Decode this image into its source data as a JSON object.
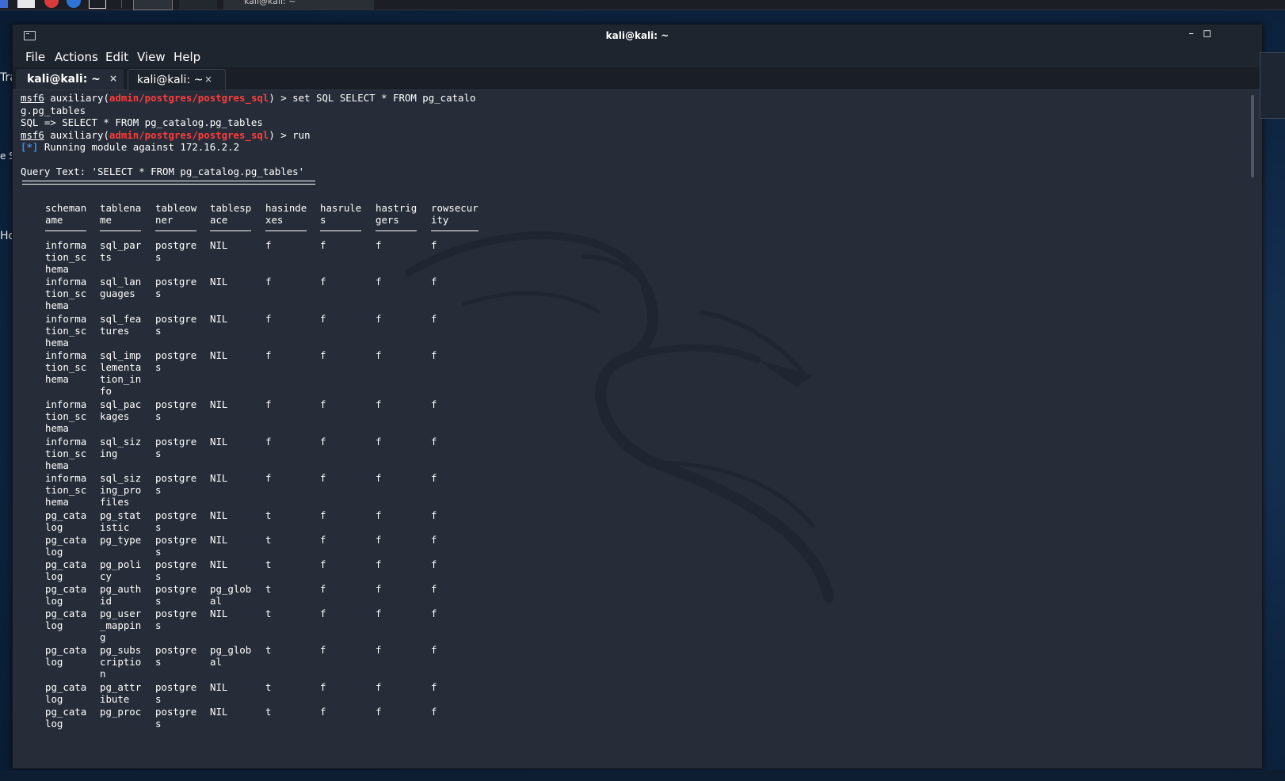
{
  "desktop": {
    "icon_labels": [
      "Tra",
      "e System",
      "Ho"
    ]
  },
  "window": {
    "title": "kali@kali: ~",
    "controls": {
      "minimize": "–",
      "maximize": "◻",
      "close": "✕"
    }
  },
  "menu": [
    "File",
    "Actions",
    "Edit",
    "View",
    "Help"
  ],
  "tabs": [
    {
      "label": "kali@kali: ~",
      "close": "×",
      "active": true
    },
    {
      "label": "kali@kali: ~",
      "close": "×",
      "active": false
    }
  ],
  "terminal": {
    "cmd1": {
      "prompt": "msf6",
      "module_prefix": " auxiliary(",
      "module": "admin/postgres/postgres_sql",
      "module_suffix": ") > ",
      "command": "set SQL SELECT * FROM pg_catalo",
      "wrap": "g.pg_tables"
    },
    "echo": "SQL => SELECT * FROM pg_catalog.pg_tables",
    "cmd2": {
      "prompt": "msf6",
      "module_prefix": " auxiliary(",
      "module": "admin/postgres/postgres_sql",
      "module_suffix": ") > ",
      "command": "run"
    },
    "info_marker": "[*]",
    "info_text": " Running module against 172.16.2.2",
    "query_text": "Query Text: 'SELECT * FROM pg_catalog.pg_tables'",
    "table": {
      "headers": [
        "scheman\name",
        "tablena\nme",
        "tableow\nner",
        "tablesp\nace",
        "hasinde\nxes",
        "hasrule\ns",
        "hastrig\ngers",
        "rowsecur\nity"
      ],
      "rows": [
        [
          "informa\ntion_sc\nhema",
          "sql_par\nts",
          "postgre\ns",
          "NIL",
          "f",
          "f",
          "f",
          "f"
        ],
        [
          "informa\ntion_sc\nhema",
          "sql_lan\nguages",
          "postgre\ns",
          "NIL",
          "f",
          "f",
          "f",
          "f"
        ],
        [
          "informa\ntion_sc\nhema",
          "sql_fea\ntures",
          "postgre\ns",
          "NIL",
          "f",
          "f",
          "f",
          "f"
        ],
        [
          "informa\ntion_sc\nhema",
          "sql_imp\nlementa\ntion_in\nfo",
          "postgre\ns",
          "NIL",
          "f",
          "f",
          "f",
          "f"
        ],
        [
          "informa\ntion_sc\nhema",
          "sql_pac\nkages",
          "postgre\ns",
          "NIL",
          "f",
          "f",
          "f",
          "f"
        ],
        [
          "informa\ntion_sc\nhema",
          "sql_siz\ning",
          "postgre\ns",
          "NIL",
          "f",
          "f",
          "f",
          "f"
        ],
        [
          "informa\ntion_sc\nhema",
          "sql_siz\ning_pro\nfiles",
          "postgre\ns",
          "NIL",
          "f",
          "f",
          "f",
          "f"
        ],
        [
          "pg_cata\nlog",
          "pg_stat\nistic",
          "postgre\ns",
          "NIL",
          "t",
          "f",
          "f",
          "f"
        ],
        [
          "pg_cata\nlog",
          "pg_type",
          "postgre\ns",
          "NIL",
          "t",
          "f",
          "f",
          "f"
        ],
        [
          "pg_cata\nlog",
          "pg_poli\ncy",
          "postgre\ns",
          "NIL",
          "t",
          "f",
          "f",
          "f"
        ],
        [
          "pg_cata\nlog",
          "pg_auth\nid",
          "postgre\ns",
          "pg_glob\nal",
          "t",
          "f",
          "f",
          "f"
        ],
        [
          "pg_cata\nlog",
          "pg_user\n_mappin\ng",
          "postgre\ns",
          "NIL",
          "t",
          "f",
          "f",
          "f"
        ],
        [
          "pg_cata\nlog",
          "pg_subs\ncriptio\nn",
          "postgre\ns",
          "pg_glob\nal",
          "t",
          "f",
          "f",
          "f"
        ],
        [
          "pg_cata\nlog",
          "pg_attr\nibute",
          "postgre\ns",
          "NIL",
          "t",
          "f",
          "f",
          "f"
        ],
        [
          "pg_cata\nlog",
          "pg_proc",
          "postgre\ns",
          "NIL",
          "t",
          "f",
          "f",
          "f"
        ]
      ]
    }
  },
  "colors": {
    "terminal_bg": "#262d39",
    "prompt_module": "#ff3b3b",
    "info_marker": "#3b8eea",
    "text": "#ffffff"
  }
}
